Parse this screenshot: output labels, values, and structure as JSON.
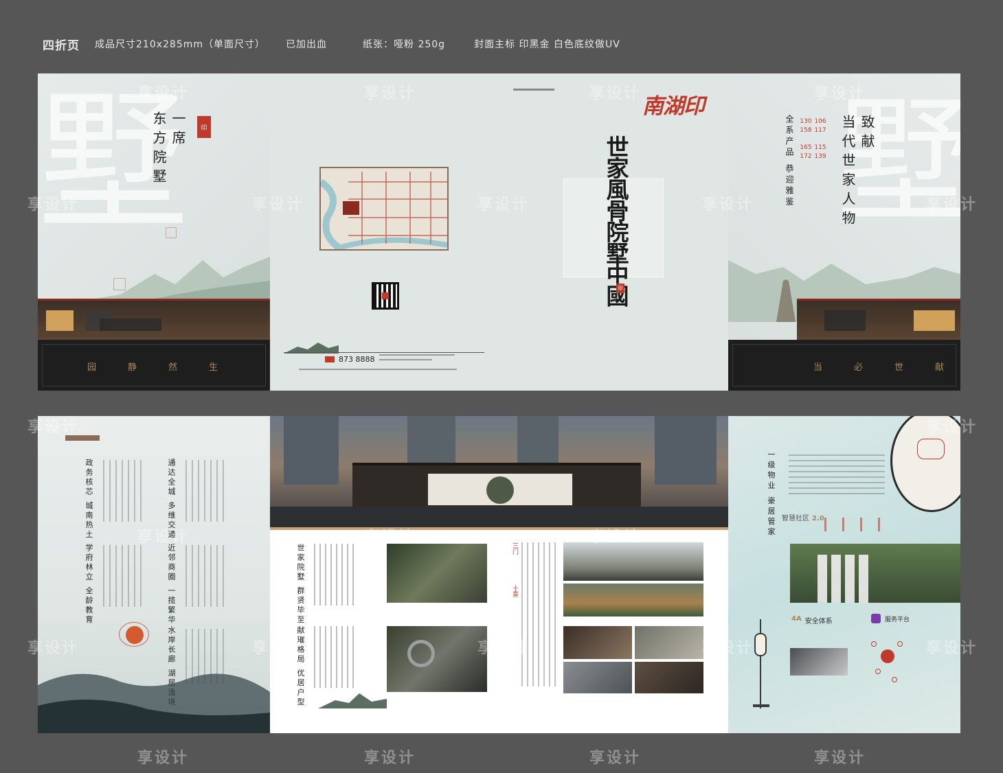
{
  "spec_bar": {
    "title": "四折页",
    "size": "成品尺寸210x285mm（单面尺寸）",
    "bleed": "已加出血",
    "paper": "纸张：哑粉 250g",
    "finish": "封面主标 印黑金  白色底纹做UV"
  },
  "watermark": "享设计",
  "panel1": {
    "heading_1": "一席",
    "heading_2": "东方院墅",
    "band_words": [
      "园",
      "静",
      "然",
      "生"
    ]
  },
  "panel2": {
    "phone_label": "873 8888"
  },
  "panel3": {
    "brand": "南湖印",
    "slogan": "世家風骨院墅中國"
  },
  "panel4": {
    "heading_1": "致献",
    "heading_2": "当代世家人物",
    "side_text": "全系产品 恭迎雅鉴",
    "areas_left": [
      "130",
      "158",
      "165",
      "172"
    ],
    "areas_right": [
      "106",
      "117",
      "115",
      "139"
    ],
    "band_words": [
      "当",
      "必",
      "世",
      "献"
    ]
  },
  "panel5": {
    "col_1": "政务核芯 城南热土",
    "col_2": "通达全城 多维交通",
    "col_3": "学府林立 全龄教育",
    "col_4": "近邻商圈 一揽繁华",
    "col_5": "水岸长廊 湖居逸境"
  },
  "panel6": {
    "title_1": "世家院墅 群贤毕至",
    "title_2": "献璀格局 优居户型",
    "label_3": "三门",
    "label_4": "十景"
  },
  "panel7": {
    "title": "一级物业 豪居管家",
    "service_label": "智慧社区",
    "service_value": "2.0",
    "grade": "4A",
    "grade_label": "安全体系",
    "app_label": "服务平台"
  },
  "colors": {
    "background": "#565656",
    "paper": "#dfe6e4",
    "accent_red": "#c0392b",
    "gold": "#a8875a",
    "dark": "#1e1e1e"
  }
}
